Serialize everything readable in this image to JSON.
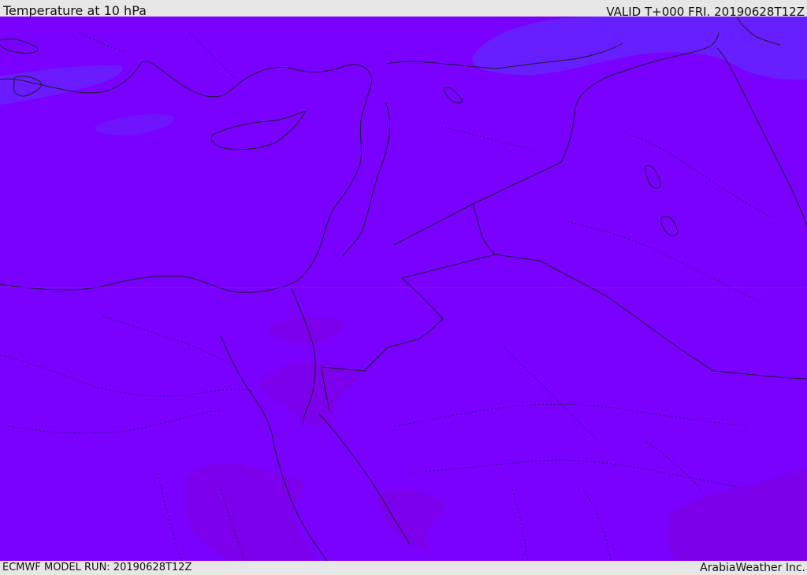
{
  "header": {
    "title": "Temperature at 10 hPa",
    "valid": "VALID T+000 FRI. 20190628T12Z"
  },
  "footer": {
    "model_run": "ECMWF MODEL RUN: 20190628T12Z",
    "credit": "ArabiaWeather Inc."
  },
  "map": {
    "colors": {
      "base_field": "#7a00ff",
      "cool_patch": "#6622ff",
      "warm_patch": "#7d00ea",
      "borders": "#1a1a2e"
    }
  }
}
